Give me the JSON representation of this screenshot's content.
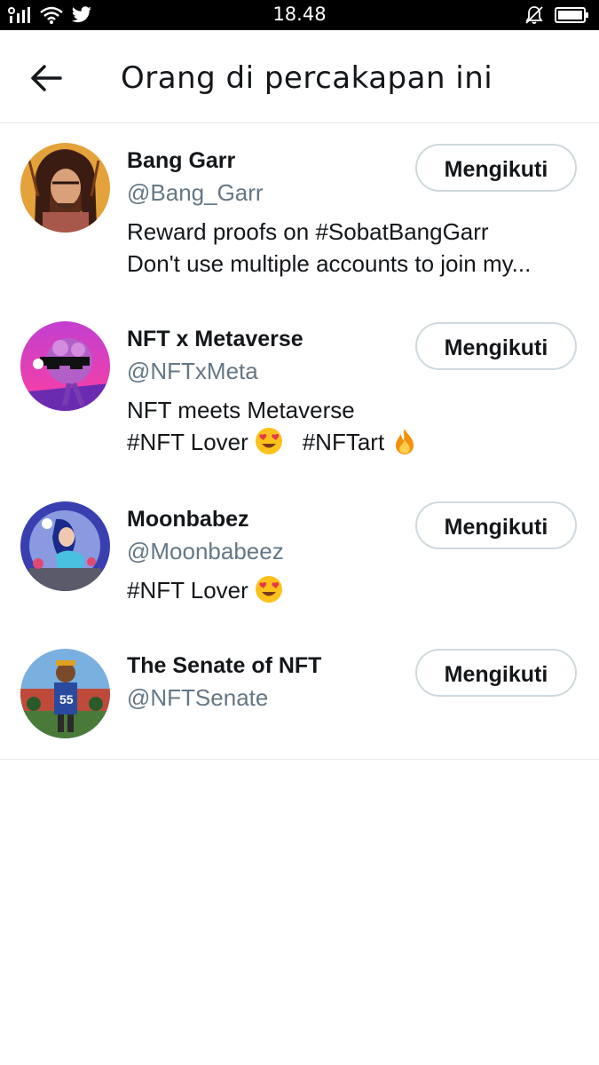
{
  "status_bar": {
    "time": "18.48",
    "signal_icon": "signal-icon",
    "wifi_icon": "wifi-icon",
    "twitter_icon": "twitter-bird-icon",
    "mute_icon": "bell-off-icon",
    "battery_icon": "battery-icon"
  },
  "header": {
    "back_icon": "back-arrow-icon",
    "title": "Orang di percakapan ini"
  },
  "users": [
    {
      "name": "Bang Garr",
      "handle": "@Bang_Garr",
      "bio_lines": [
        "Reward proofs on #SobatBangGarr",
        "Don't use multiple accounts to join my..."
      ],
      "button": "Mengikuti"
    },
    {
      "name": "NFT x Metaverse",
      "handle": "@NFTxMeta",
      "bio_lines": [
        "NFT meets Metaverse",
        "#NFT Lover",
        "#NFTart"
      ],
      "button": "Mengikuti"
    },
    {
      "name": "Moonbabez",
      "handle": "@Moonbabeez",
      "bio_lines": [
        "#NFT Lover"
      ],
      "button": "Mengikuti"
    },
    {
      "name": "The Senate of NFT",
      "handle": "@NFTSenate",
      "bio_lines": [],
      "button": "Mengikuti"
    }
  ],
  "colors": {
    "text_primary": "#14171a",
    "text_secondary": "#657786",
    "border": "#cfd9de",
    "divider": "#e1e8ed"
  }
}
